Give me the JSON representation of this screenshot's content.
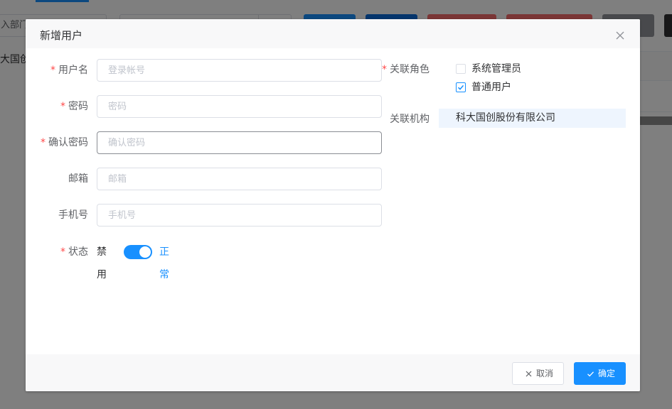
{
  "background": {
    "dept_search_text": "入部门名",
    "tree_root_label": "大国创"
  },
  "dialog": {
    "title": "新增用户",
    "close_icon": "close-icon"
  },
  "form": {
    "username": {
      "label": "用户名",
      "placeholder": "登录帐号",
      "value": ""
    },
    "password": {
      "label": "密码",
      "placeholder": "密码",
      "value": ""
    },
    "confirm_password": {
      "label": "确认密码",
      "placeholder": "确认密码",
      "value": ""
    },
    "email": {
      "label": "邮箱",
      "placeholder": "邮箱",
      "value": ""
    },
    "phone": {
      "label": "手机号",
      "placeholder": "手机号",
      "value": ""
    },
    "status": {
      "label": "状态",
      "off_label": "禁用",
      "on_label": "正常",
      "enabled": true
    }
  },
  "roles": {
    "label": "关联角色",
    "options": [
      {
        "label": "系统管理员",
        "checked": false
      },
      {
        "label": "普通用户",
        "checked": true
      }
    ]
  },
  "org": {
    "label": "关联机构",
    "value": "科大国创股份有限公司"
  },
  "footer": {
    "cancel_label": "取消",
    "confirm_label": "确定"
  },
  "colors": {
    "primary": "#1890ff",
    "required": "#ff4949",
    "org_highlight": "#eef5fe"
  }
}
